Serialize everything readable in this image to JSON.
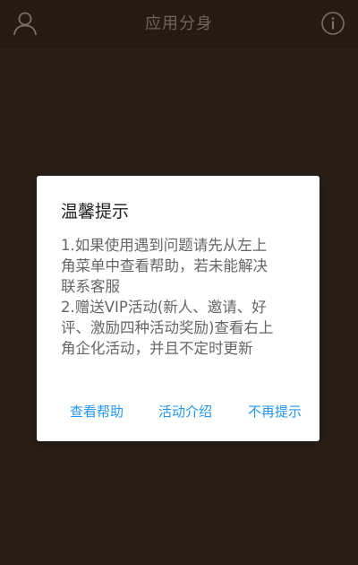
{
  "header": {
    "title": "应用分身",
    "left_icon": "user-icon",
    "right_icon": "info-icon"
  },
  "dialog": {
    "title": "温馨提示",
    "message_lines": [
      "1.如果使用遇到问题请先从左上",
      "角菜单中查看帮助，若未能解决",
      "联系客服",
      "2.赠送VIP活动(新人、邀请、好",
      "评、激励四种活动奖励)查看右上",
      "角企化活动，并且不定时更新"
    ],
    "buttons": {
      "help": "查看帮助",
      "activity": "活动介绍",
      "no_remind": "不再提示"
    }
  },
  "colors": {
    "background": "#2e2319",
    "header_text": "#7d7066",
    "accent": "#2196f3",
    "dialog_bg": "#ffffff"
  }
}
